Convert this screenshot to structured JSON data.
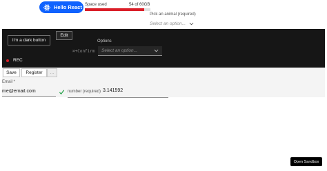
{
  "header": {
    "hello_button_label": "Hello React",
    "hello_icon": "react-icon",
    "space": {
      "label": "Space used",
      "value_text": "54 of 60GB",
      "used_fraction": 0.9,
      "bar_color": "#da1e28"
    },
    "animal": {
      "label": "Pick an animal (required)",
      "placeholder": "Select an option..."
    }
  },
  "dark_section": {
    "edit_label": "Edit",
    "dark_button_label": "I'm a dark button",
    "options_label": "Options",
    "confirm_label": "⌘+Confirm",
    "select_placeholder": "Select an option...",
    "rec_label": "REC",
    "rec_color": "#da1e28"
  },
  "form": {
    "save_label": "Save",
    "register_label": "Register",
    "extra_label": "...",
    "email_label": "Email *",
    "email_value": "me@email.com",
    "number_label": "number (required)",
    "number_value": "3.141592"
  },
  "footer": {
    "sandbox_label": "Open Sandbox"
  },
  "colors": {
    "accent": "#0f62fe",
    "dark_bg": "#161616",
    "success": "#24a148"
  }
}
